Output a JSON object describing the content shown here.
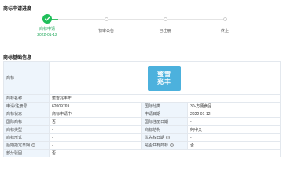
{
  "progress": {
    "title": "商标申请进度",
    "steps": [
      {
        "label": "商标申请",
        "date": "2022-01-12",
        "state": "done"
      },
      {
        "label": "初审公告",
        "date": "",
        "state": "pending"
      },
      {
        "label": "已注册",
        "date": "",
        "state": "pending"
      },
      {
        "label": "终止",
        "date": "",
        "state": "pending"
      }
    ]
  },
  "info": {
    "title": "商标基础信息",
    "logo_label": "商标",
    "logo_text": [
      "蜜雪",
      "兆丰"
    ],
    "trademark_name_label": "商标名称",
    "trademark_name": "蜜雪兆丰年",
    "rows": [
      {
        "k1": "申请/注册号",
        "v1": "62009769",
        "k2": "国际分类",
        "v2": "30-方便食品"
      },
      {
        "k1": "商标状态",
        "v1": "商标申请中",
        "k2": "申请日期",
        "v2": "2022-01-12"
      },
      {
        "k1": "国际商标",
        "v1": "否",
        "k2": "国际注册日期",
        "v2": "-"
      },
      {
        "k1": "商标类型",
        "v1": "-",
        "k2": "商标结构",
        "v2": "纯中文"
      },
      {
        "k1": "商标形式",
        "v1": "-",
        "k2": "优先权日期",
        "v2": "-"
      },
      {
        "k1": "后期指定日期",
        "v1": "-",
        "k2": "是否共有商标",
        "v2": "否"
      }
    ],
    "partial_reject_label": "部分驳回",
    "partial_reject": "否"
  },
  "colors": {
    "accent": "#1fbf5a",
    "key_bg": "#eef5fc",
    "logo_bg": "#4cb1dd"
  }
}
